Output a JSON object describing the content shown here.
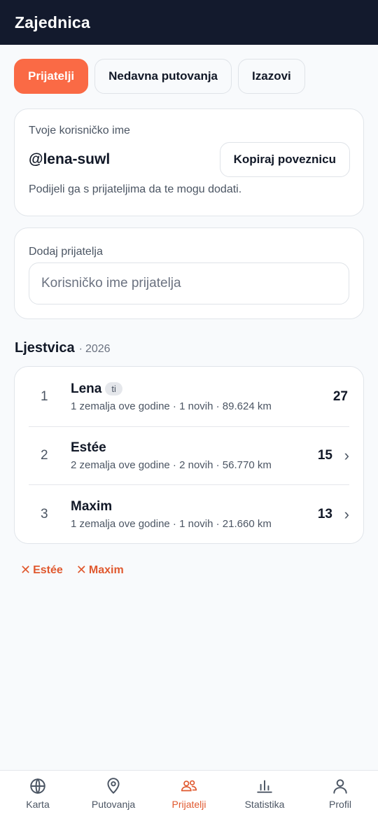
{
  "header": {
    "title": "Zajednica"
  },
  "tabs": [
    {
      "label": "Prijatelji",
      "active": true
    },
    {
      "label": "Nedavna putovanja",
      "active": false
    },
    {
      "label": "Izazovi",
      "active": false
    }
  ],
  "user_card": {
    "label": "Tvoje korisničko ime",
    "handle": "@lena-suwl",
    "copy_label": "Kopiraj poveznicu",
    "hint": "Podijeli ga s prijateljima da te mogu dodati."
  },
  "add_card": {
    "label": "Dodaj prijatelja",
    "placeholder": "Korisničko ime prijatelja",
    "value": ""
  },
  "leaderboard": {
    "title": "Ljestvica",
    "separator": "·",
    "year": "2026",
    "rows": [
      {
        "rank": "1",
        "name": "Lena",
        "badge": "ti",
        "meta": "1 zemalja ove godine · 1 novih · 89.624 km",
        "score": "27"
      },
      {
        "rank": "2",
        "name": "Estée",
        "meta": "2 zemalja ove godine · 2 novih · 56.770 km",
        "score": "15"
      },
      {
        "rank": "3",
        "name": "Maxim",
        "meta": "1 zemalja ove godine · 1 novih · 21.660 km",
        "score": "13"
      }
    ]
  },
  "remove": [
    {
      "label": "Estée"
    },
    {
      "label": "Maxim"
    }
  ],
  "nav": [
    {
      "label": "Karta",
      "icon": "globe-icon"
    },
    {
      "label": "Putovanja",
      "icon": "map-pin-icon"
    },
    {
      "label": "Prijatelji",
      "icon": "users-icon",
      "active": true
    },
    {
      "label": "Statistika",
      "icon": "bar-chart-icon"
    },
    {
      "label": "Profil",
      "icon": "user-icon"
    }
  ],
  "colors": {
    "accent": "#fa6a45",
    "danger": "#e0592f",
    "header_bg": "#131a2d"
  }
}
